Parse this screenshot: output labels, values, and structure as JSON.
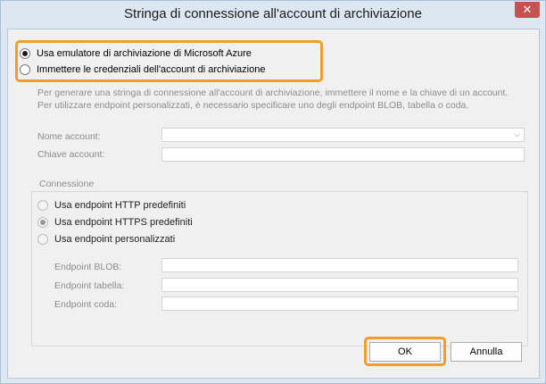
{
  "window": {
    "title": "Stringa di connessione all'account di archiviazione",
    "close_glyph": "✕"
  },
  "mode_options": [
    {
      "label": "Usa emulatore di archiviazione di Microsoft Azure",
      "selected": true
    },
    {
      "label": "Immettere le credenziali dell'account di archiviazione",
      "selected": false
    }
  ],
  "description": {
    "line1": "Per generare una stringa di connessione all'account di archiviazione, immettere il nome e la chiave di un account.",
    "line2": "Per utilizzare endpoint personalizzati, è necessario specificare uno degli endpoint BLOB, tabella o coda."
  },
  "account_name": {
    "label": "Nome account:",
    "value": "",
    "chevron": "⌵"
  },
  "account_key": {
    "label": "Chiave account:",
    "value": ""
  },
  "connection": {
    "group_title": "Connessione",
    "options": [
      {
        "label": "Usa endpoint HTTP predefiniti",
        "selected": false
      },
      {
        "label": "Usa endpoint HTTPS predefiniti",
        "selected": true
      },
      {
        "label": "Usa endpoint personalizzati",
        "selected": false
      }
    ],
    "endpoints": {
      "blob_label": "Endpoint BLOB:",
      "table_label": "Endpoint tabella:",
      "queue_label": "Endpoint coda:"
    }
  },
  "buttons": {
    "ok": "OK",
    "cancel": "Annulla"
  },
  "colors": {
    "highlight": "#f39c2c",
    "close": "#c75050",
    "frame": "#dce7f2"
  }
}
